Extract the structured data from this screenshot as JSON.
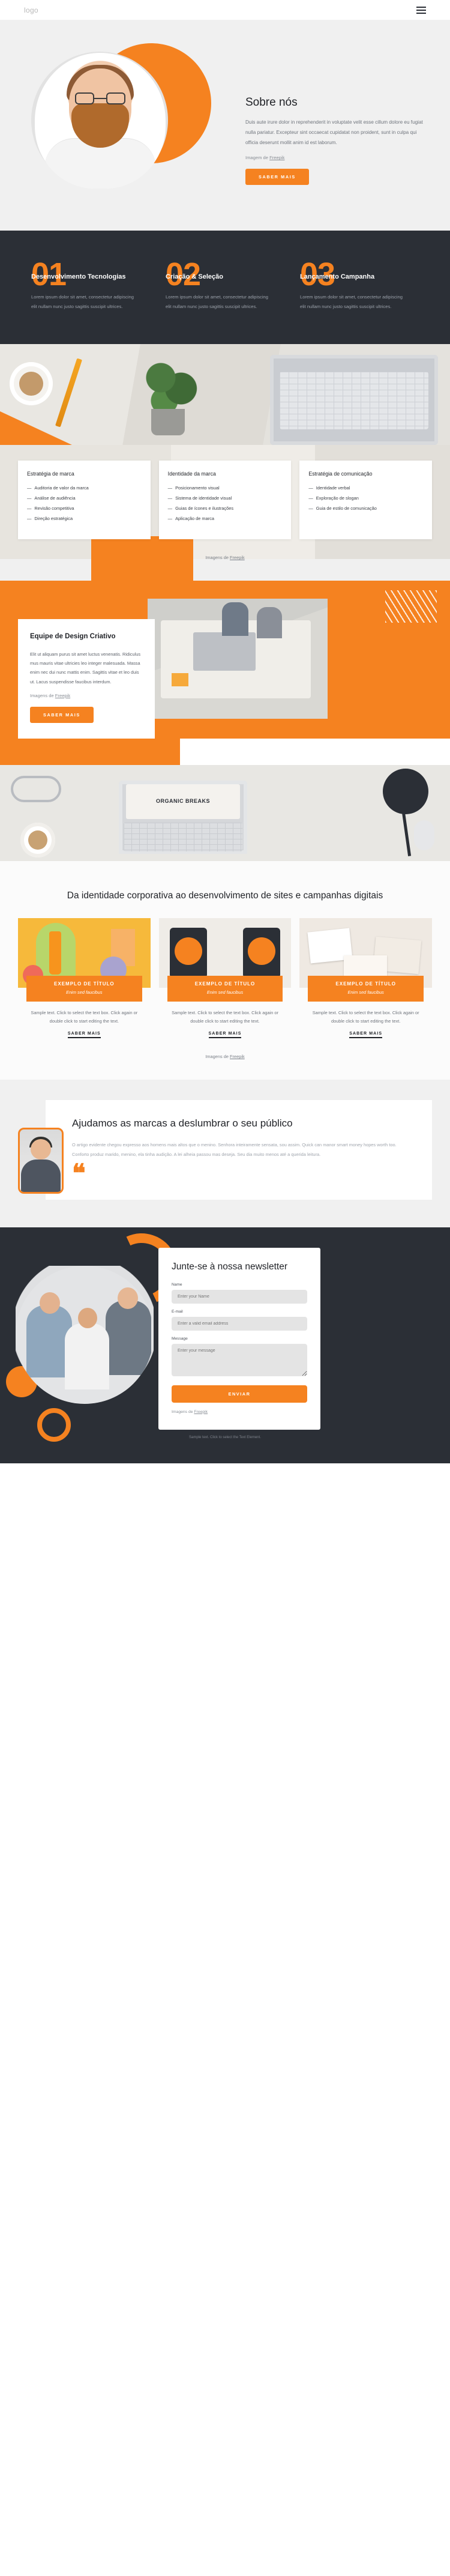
{
  "header": {
    "logo": "logo",
    "menu_icon": "hamburger-menu-icon"
  },
  "hero": {
    "title": "Sobre nós",
    "paragraph": "Duis aute irure dolor in reprehenderit in voluptate velit esse cillum dolore eu fugiat nulla pariatur. Excepteur sint occaecat cupidatat non proident, sunt in culpa qui officia deserunt mollit anim id est laborum.",
    "credit_prefix": "Imagem de ",
    "credit_link": "Freepik",
    "button": "SABER MAIS"
  },
  "steps": [
    {
      "num": "01",
      "title": "Desenvolvimento Tecnologias",
      "desc": "Lorem ipsum dolor sit amet, consectetur adipiscing elit nullam nunc justo sagittis suscipit ultrices."
    },
    {
      "num": "02",
      "title": "Criação & Seleção",
      "desc": "Lorem ipsum dolor sit amet, consectetur adipiscing elit nullam nunc justo sagittis suscipit ultrices."
    },
    {
      "num": "03",
      "title": "Lançamento Campanha",
      "desc": "Lorem ipsum dolor sit amet, consectetur adipiscing elit nullam nunc justo sagittis suscipit ultrices."
    }
  ],
  "strategy": {
    "cards": [
      {
        "title": "Estratégia de marca",
        "items": [
          "Auditoria de valor da marca",
          "Análise de audiência",
          "Revisão competitiva",
          "Direção estratégica"
        ]
      },
      {
        "title": "Identidade da marca",
        "items": [
          "Posicionamento visual",
          "Sistema de identidade visual",
          "Guias de ícones e ilustrações",
          "Aplicação de marca"
        ]
      },
      {
        "title": "Estratégia de comunicação",
        "items": [
          "Identidade verbal",
          "Exploração de slogan",
          "Guia de estilo de comunicação"
        ]
      }
    ],
    "credit_prefix": "Imagens de ",
    "credit_link": "Freepik"
  },
  "team": {
    "title": "Equipe de Design Criativo",
    "paragraph": "Elit ut aliquam purus sit amet luctus venenatis. Ridiculus mus mauris vitae ultricies leo integer malesuada. Massa enim nec dui nunc mattis enim. Sagittis vitae et leo duis ut. Lacus suspendisse faucibus interdum.",
    "credit_prefix": "Imagens de ",
    "credit_link": "Freepik",
    "button": "SABER MAIS"
  },
  "band2": {
    "screen_text": "ORGANIC BREAKS"
  },
  "gallery": {
    "title": "Da identidade corporativa ao desenvolvimento de sites e campanhas digitais",
    "items": [
      {
        "label": "EXEMPLO DE TÍTULO",
        "sub": "Enim sed faucibus",
        "body": "Sample text. Click to select the text box. Click again or double click to start editing the text.",
        "link": "SABER MAIS"
      },
      {
        "label": "EXEMPLO DE TÍTULO",
        "sub": "Enim sed faucibus",
        "body": "Sample text. Click to select the text box. Click again or double click to start editing the text.",
        "link": "SABER MAIS"
      },
      {
        "label": "EXEMPLO DE TÍTULO",
        "sub": "Enim sed faucibus",
        "body": "Sample text. Click to select the text box. Click again or double click to start editing the text.",
        "link": "SABER MAIS"
      }
    ],
    "credit_prefix": "Imagens de ",
    "credit_link": "Freepik"
  },
  "quote": {
    "title": "Ajudamos as marcas a deslumbrar o seu público",
    "paragraph": "O artigo evidente chegou expresso aos homens mais altos que o menino. Senhora inteiramente sensata, sou assim. Quick can manor smart money hopes worth too. Conforto produz marido, menino, ela tinha audição. A lei alheia passou mas deseja. Seu dia muito menos até a querida leitura.",
    "mark": "❝"
  },
  "newsletter": {
    "title": "Junte-se à nossa newsletter",
    "name_label": "Name",
    "name_placeholder": "Enter your Name",
    "email_label": "E-mail",
    "email_placeholder": "Enter a valid email address",
    "message_label": "Message",
    "message_placeholder": "Enter your message",
    "button": "ENVIAR",
    "credit_prefix": "Imagens de ",
    "credit_link": "Freepik"
  },
  "footer": {
    "copyright": "Sample text. Click to select the Text Element."
  },
  "colors": {
    "accent": "#f58220",
    "dark": "#2b2f36",
    "light": "#f0f0f0"
  }
}
